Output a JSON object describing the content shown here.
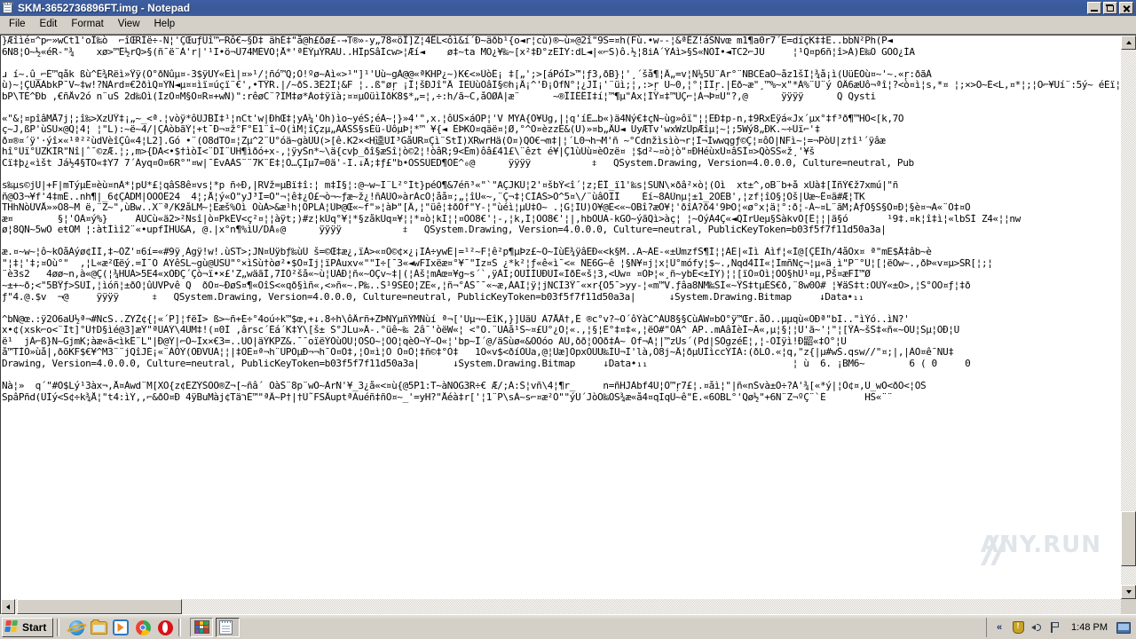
{
  "window": {
    "title": "SKM-3652736896FT.img - Notepad",
    "icon": "notepad-icon",
    "controls": {
      "minimize": "Minimize",
      "restore": "Restore",
      "close": "Close"
    }
  },
  "menu": {
    "items": [
      {
        "label": "File"
      },
      {
        "label": "Edit"
      },
      {
        "label": "Format"
      },
      {
        "label": "View"
      },
      {
        "label": "Help"
      }
    ]
  },
  "editor": {
    "watermark": "ANY.RUN",
    "lines": [
      "}Æîìé¤^p⌐»wCt1'oÏ‰ò  ⌐îŒRÍë÷-N¦'ÇŒuƒÛî™⌐Rô€~§D‡ ähÉ‡\"å@h£ðø£-→T®»-y„78«öÏ]Z¦4ËL<ôì&í´Ð~äðb¹{o◄r¦cù)®~ù»@2î\"9S=¤h(Fù.•w--¦&ªËZ!áŠNvœ m1¶a0r7´E=díçK‡‡E..bbN²Ph(P◄",
      "6Ñ8¦Ò~½«éR-\"¾    xø>™Ë½rQ>§(ñ¯ë¨À'r|'¹I•ö¬Û74MÈVÖ¦Å*'ªÊÝµÝRAÜ..HÎpSâÌcw>¦Æí◄    ø‡~ta MO¿¥‰~[x²‡Ð°zEÍY:dL◄|«⌐S)ô.½¦8iÃ´ÝÀì>§Š«ÑÒÍ•◄TC2⌐JÙ     ¦¹Q¤p6ñ¦î>À)É‰Ô GÓÓ¿ÍÃ",
      "",
      "ɹ í~.û_⌐É™qåk ßù^É¾Rëì»Ÿÿ(Ò°ðÑûµ¤-3$ÿÜY«Éì|¤»¹/¦ñó™Q;Ò!ºø~Ãì«>¹\"]¹'Uù~gÀ@@«ªKHP¿~)K€<»ÙòÊ¡ ‡[„';>[áPóÎ>™¦ƒ3,ðB}¦'¸´šå¶¦Ä„=v¦Ñ¼5Ù¨Ãr°¨NBCÈaÓ~åz1šÎ¦¾å¡ì(ÙüÉÓù¤~'~.«ŗ:ðãÀ",
      "ù)~¦ÇÙÄÀbkP¯V~‡w!?NÁrd¤€2ðìQ¤ÝÑ◄µ¤¤ìï¤úçï¨€',•TŸR.|/~ðS.3È2Î¦&F ¦..ß\"øŗ ¡Ï¦šÐJî\"Ä ÌÈÙùÒâÎ§©h¡Ä¡^'Ð¡ÓfÑ°¦¿JÎ¡'¨üì;¦,:>ŗ Ù~0,¦°¦ÌÎŗ.|Ëð~æ\"¸™%~x\"*Á%¨Ù¨ý ÒÄ6æÙô¬ªî¦?<ò¤ì¦s,*¤ ¦;×>Ó~É<L,¤*¦;¦O⌐¥Uí¨:5ý~ éÉï¦Óò§É",
      "bP\\TÉ^Ðb ,€ñÅv2ó n¨uŠ 2d‰Òì(ÍzÔ¤M§Ó¤R¤+wN)\":rêøC¨?ÎM‡ø*Áo‡ÿïà;¤¤µÓüìÍðK8$*„=¦,÷:h/ã~C,åÒØÀ|æ¨      ~®ÏÌÊËÍ‡í¦™¶µ\"Áx¦ÍŸ¤‡™ÙÇ⌐¦À¬Þ¤Ù\"?,@      ÿÿÿÿ      Q Qysti",
      "",
      "«\"&¦¤pîâMÅ7j¦;î‰>XzÙŸ‡¡„~_<ª.¦vòÿ*ôÚJBÏ‡¹¦nCt'w|ÐhŒ‡¦yÀ¼'Òh)ìo~yéŠ;éÀ~¦}»4'\",x.¦ôÙS×áÓP¦'V MYÀ{Ò¥Ùg,|¦q'íÈ…b«)ä4Ný€‡çN~ùg»ôï\"¦¦ÊÐ‡p-n,‡9RxÈÿá«Jx´µx°‡f³ð¶™HÒ<[k,7Ò",
      "ç~J,ßP'ùŠÙ×@Q¦4¦ ¦\"L):~ë~4/|ÇÁòbãÝ¦+t¯Ð¬¤ž°F°E1¨î~Ò(ìM¦îÇzµ„ÀÂŠŠ§sÈü-ÙôµÞ¦*™ ¥{◄ ÊÞKÒ¤qäë¤¦Ø,°^Ò¤èzzÈ&(Ü)»¤b„ÄÙ◄ UyÆTv'wxWzÙpÆîµ¦~¦;5Wý8„ÐK.~÷Ûï⌐'‡",
      "ð¤®¤´ÿ'·ýî×«¹ª²²ùdVèîÇû«4¦L2].Gó •¨(Ò8dTÒ¤¦Zµ^2¨Ù°óä~gàÙÛ(>[ê.K2×<H逵ÙÍ³GåÜR¤Çì¨ŠtÏ)XRwrHä(Ò¤)QÒ€¬m‡|¦´L0¬h¬M'ñ ~°Cdnžìsìò¬r¦Ì¬Ìwwqgƒ©Ç¦¤ôÒ|NFì~¦=¬PòÙ|z†î¹´ÿâæ",
      "hî°Ûï°ÚZKÌR\"Ñî|ˆ¯©zÆ.¦;,m>{DÀ<•$†ìòÌ<¨DÌ¨ÙH¶ìðó+x-,¦ÿyŠn*~\\ä{cvþ_ðî§æŠî¦ò©2¦!òâR;9<Êm)ôâ£41£\\¨êzt é¥|Ç1ùÙù¤èÒzë¤ ¦$d²~¤ò¦ò\"¤ÐHéùxÙ¤âSÌ¤>QòSS«ž¸'¥š",
      "Cï‡þ¿«ìšt Já½4§TO«‡Y7 7´Áyq¤Ó¤6R°\"¤w|¯ÉvAÀS¨¨7K¨Ê‡¦Ò…ÇIµ7=0ä'-I.↓Å;‡ƒ£\"b•ÒSSÙED¶ÒÈ^₀@      ÿÿÿÿ           ⧧   QSystem.Drawing, Version=4.0.0.0, Culture=neutral, Pub",
      "",
      "s‰µs©jU|+F|mTýµÊ¤èù¤nÀ*¦pU*£¦qâS8ê¤vs¦*p ñ÷Ð,|RVž=µBï‡î:¦ m‡Ì§¦:@~w~I¨L²°Ít}péÓ¶&7éñ³«\"`\"AÇJKÙ¦2'¤šbÝ<î´¦z;ËÏ_ï1'‰s¦SÙÑ\\×ðâ²×ò¦(Òì  xt±^,oB¨b+å xÙà‡[ÎñÝ€ž7xmú|\"ñ",
      "ñ@Ó3¬¥f'4‡mÉ..nh¶|_6¢ÇÀDM|ÒÒÒÊ24  4¦;Å¦ý«Ò\"yJ³Ì=Ò\"¬¦ê‡¿Ò£¬ò¬~ƒæ~ž¿!ñÀÙÒ»àrÀcÒ¦åå¤;„¦îÛ«~,¨Ç¬‡¦CÌÀŠ>Ò^5¤\\/¨ùâÒÎÏ    Éí~8ÀÙnµ¦±1_2ÒÈB',¦zf¦îÒ§¦Òš|Ùæ~Ë¤ã#Æ¦TK",
      "THhNòÛVÅ»»Ò8~M ë,¨Z~\",ùBw..X¨ª/K߶åLM~¦Eæš%Òì ÒùÀ>&æ¹h¦ÓPLÀ¦ÙÞ@Œ«~f\"»¦àÞ\"[Ä,¦\"üê¦‡ðÓf\"Y-¦\"ùéì¦µÙ‡Ò~ .¦G¦ÍU)Ò¥@È<«~ÒBî?æÒ¥¦'ðîÀ?ð4'9ÞÒ¦«ø°x¦ä¦°:ð¦-Á~¤L¨ãM;ÁƒÒ§Š§Ò¤Ð¦§è¤¬Ã«¨Ò‡¤Ò",
      "æ¤        §¦'ÒÀ¤ý%}     ÀÙCù«ä2>²Nsî|ò¤PkÈV<ç²¤¦¦àÿt;)#z¦kÙq°¥¦*§zåkÙq¤¥¦¦*¤ò¦kÍ¦¦¤ÒÒ8€'¦-,¦k,Í¦ÒÒ8€'¦|,hbÒÜÀ-kGÒ~ýãQì>àç¦ ¦~ÒýÀ4Ç«◄QÍrUeµ§ŠàkvÒ[Ê¦¦|ã§ó       ¹9‡.¤k¦î‡ì¦«lbŠÍ Z4«¦¦nw",
      "ø¦8QN~5wÓ eŧOM ¦:àtÍìî2¨«•upfÌHÙ&A, @.|x°n¶%ìÙ/DÀ₀@      ÿÿÿÿ           ⧧   QSystem.Drawing, Version=4.0.0.0, Culture=neutral, PublicKeyToken=b03f5f7f11d50a3a|",
      "",
      "æ.¤~w~¦ô~kÒåÀýø¢ÍÌ,‡~ÒŽ'¤6í=«#9ÿ¸Àgÿ!w!.ùST>;JN¤Ùÿbƒ‰ùÛ š=©Œ‡æ¿,ïÀ>«¤Ò©¢×¿¡IÀ÷ywÉ|=¹²~F¦ê²p¶µÞz£~Ò~ÌùÉ¾ÿâÉÐ«<k§M..Ã~ÁÉ-«±ÙmzfŠ¶Í¦¦ÀÉ|«Ìì Àìf¦«Ì@[ÇÊÍh/4åÒx¤ ª\"mE$Å‡âb~è",
      "\"¦‡¦'‡;¤Òù°\"  ,¦L«æ²Œëý.=Ì¯Ó ÀÝêSL~gù@ÙSÛ\"°×ìŠù†òø²•$Ò¤Ìj¦ïPÀuxv«\"\"Ì÷[¯3«◄wFIxëæ¤°¥¯\"Ìz¤Š ¿*k²¦ƒ«ê«ì¯<« NE6G~ê ¦§Ñ¥¤j¦x¦Ù°mófy¦$~.,Ñqd4ÌÌ«¦ÌmñÑç¬¦µ«ä¸ì\"P¨°Ù¦[¦ëÒw~.,ðÞ«v¤µ>ŠR[¦;¦",
      "¨è3s2   4øø~n,à«@Ç(¦¾HUÀ>5E4«xÒÐÇ´Çò¬ï•×£'Z„wäãÌ,7ÌÒ²šå«~ù¦ÙÀÐ¦ñ«~ÒÇv~‡|(¦Àš¦mÀœ¤¥g~s´`,ÿÀÌ;ÒÙÌÌÙÐÙÌ«ÌðÉ«š¦3,<Ùw¤ ¤ÒÞ¦«¸ñ~ybÉ<±ÌÝ)¦¦[ïÒ¤Òì¦ÒÒ§hÙ¹¤µ,Pš¤æFÌ™Ø",
      "~±+~ð;<\"5BŸƒ>ŠÙÌ,¦ìóñ¦±ðÒ¦ûÙVPvê Q  ðÒ¤~ÐøS¤¶«ÒîŠ<«qð§ìñ«,<»ñ«~.P‰..Š¹9ŠÉÒ¦ZÉ«,¦ñ¬°ÀŠ¯¯«~æ,ÀAÌ¦ÿ¦jNCÌ3Ÿ¯«×r{Ò5¯>yy-¦«m™V.ƒâa8NM‰ŠÌ«~ŸŠ‡tµÉŠ€ð,¨8w0Ò# ¦¥äŠ‡t:ÒÙÝ«±Ò>,¦Š°ÒÒ¤ƒ¦‡ð",
      "ƒ\"4.@.$v  ¬@     ÿÿÿÿ      ⧧   QSystem.Drawing, Version=4.0.0.0, Culture=neutral, PublicKeyToken=b03f5f7f11d50a3a|      ↓System.Drawing.Bitmap     ↓Data•₁₁",
      "",
      "^bÑ@œ.:ÿ2Ò6aÙ½ª¬#NcŠ..ZYŽ¢{¦«´P]¦fëÏ> ß>~ñ+É÷°4oú÷k™$œ,+↓.8÷h\\ôÄrñ+ZÞNYµñÝMÑùí ª¬['Uµ¬~ÉîK,}]ÙäÙ À7ÅÂ†,É ®c°v?~O´ôÝàC^ÀÙ8§§CùÀW¤bÒ°ÿ™Œr.åÒ..µµqù«ÒÐª\"bÍ..\"ìÝó..ìN?'",
      "x•¢(xsk⌐o<¨Ìt]°Ù†D§ìé@3]æÝ\"ªÙÀÝ\\4ÙM‡!(¤0Ì ,ârsc´Éá´K‡Ý\\[š± Š°JLu»Ä-.°üê~‰ 2â¯'òëW«¦ <°Ò.¨ÙÀå¹Š~¤£Ù°¿Ò¦«.,¦§¦È°‡¤‡«,¦ëÒ#\"ÒÀ^ ÀP..mÀâÌèÌ~Ä«,µ¦§¦¦Ù'ã~'¦\"¦[ŸÀ~šŠ‡«ñ«~ÒÙ¦Šµ¦ÒÐ¦Ù",
      "ë¹  jÀ⌐ß}N~GjmK;àæ«ã<ìkÊ¨L\"|Ð@Ý|⌐Ò~Ìx×€3=..UÒ|äÝKPZ&.¯¯oïëÝÒùÒÙ¦ÒŠÒ~¦ÒÒ¦qèÒ¬Ý~Ò«¦'bp~Ï´@/äŠùø«&ÒÒóo ÀÙ,ðð¦ÒÒð‡À~ Òf¬À¦|™zÙs´(Pd|ŠÒgzéÉ¦,¦-ÒÍÿì!Ð鼦«‡Ò°¦Ù",
      "å™TÌÒ»ùå|,ðõKF$€¥^M3¨¨jQîJÉ¡«¨ÀÒÝ(ÒÐVÙÀ¦¦|‡ÓÈ¤ª¬h¨ÙPÒµÐ¬¬h¯Ò¤Ò‡,¦Ò¤ì¦Ò Ò¤Ò¦‡ñ©‡°Ò‡   1Ò«v$<ðíÒÙa,@¦Ùæ]ÒpxÒÙÙ‰ÌÙ¬Ì'là,Ò8j~Ä¦ðµÙÌìccÝÌÀ:(ðLÒ.«¦q,\"z{|µ#wŠ.qsw//\"¤;|,|ÀÒ¤ê¯NU‡",
      "Drawing, Version=4.0.0.0, Culture=neutral, PublicKeyToken=b03f5f7f11d50a3a|      ↓System.Drawing.Bitmap     ↓Data•₁₁                          ¦ ù  6. ¡BM6~        6 ( 0     0",
      "",
      "Ñà¦»  q´\"#Ò$Lý¹3àx¬,Å¤Àwd¨M[XÒ{z¢ÉZÝŠÒÒ®Z¬[~ñâ´ ÒàŠ¨8p¨wÒ~ÀrN'¥_3¿å«<¤ù{@5P1:T~àNÒG3R÷€ Æ/;À:Š¦vñ\\4¦¶r_     n=ñHJÀbf4Ù¦Ò™ŗ7£¦.¤åì¦\"|ñ«nŠvà±Ò÷?À'¾[«*ý|¦Ò¢¤,Ù_wÒ<ðÒ<¦ÒŠ",
      "SpâPñd(ÙÍý<S¢÷k¾Å¦\"t4:ìÝ,,⌐&ðÒ¤Ð 4ÿBuMàj¢TäרÉ™\"ªÄ~P†|†Ù˜FSÄuptªÀuéñ‡ñÒ¤~_'=yH?\"Åéà‡r['¦1¨P\\sÀ~s⌐¤æ²Ò\"\"ýÚ´JòÒ‰ÒS¾æ«å4¤qÌqÛ~ê\"É.«6ÒBL°'Qø½\"+6Ñ¨Z¬ºÇ¨`É       HŠ«¨¨"
    ]
  },
  "scrollbars": {
    "vertical": {
      "up": "scroll-up",
      "down": "scroll-down",
      "thumb": "vertical-thumb"
    },
    "horizontal": {
      "left": "scroll-left",
      "right": "scroll-right",
      "thumb": "horizontal-thumb"
    }
  },
  "taskbar": {
    "start_label": "Start",
    "quick_launch": [
      {
        "name": "internet-explorer-icon"
      },
      {
        "name": "file-explorer-icon"
      },
      {
        "name": "media-player-icon"
      },
      {
        "name": "chrome-icon"
      },
      {
        "name": "opera-icon"
      },
      {
        "name": "grid-app-icon"
      }
    ],
    "task_buttons": [
      {
        "label": "",
        "name": "taskbar-item-notepad"
      }
    ],
    "tray": {
      "chevron": "«",
      "clock": "1:48 PM"
    }
  }
}
